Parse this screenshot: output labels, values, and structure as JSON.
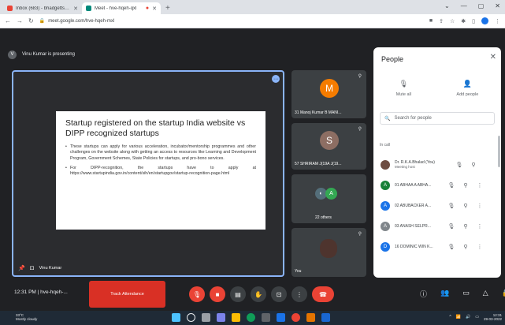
{
  "browser": {
    "tabs": [
      {
        "label": "Inbox (683) - bhadgetts@iatrc.co",
        "active": false,
        "favicon_color": "#ea4335"
      },
      {
        "label": "Meet - hve-hqeh-qxl",
        "active": true,
        "favicon_color": "#00897b"
      }
    ],
    "new_tab": "+",
    "url": "meet.google.com/hve-hqeh-mxl"
  },
  "meet": {
    "presenting_banner": "Vinu Kumar is presenting",
    "slide": {
      "title": "Startup registered on the startup India website vs DIPP recognized startups",
      "bullets": [
        "These startups can apply for various acceleration, incubator/mentorship programmes and other challenges on the website along with getting an access to resources like Learning and Development Program, Government Schemes, State Policies for startups, and pro-bono services.",
        "For DIPP-recognition, the startups have to apply at https://www.startupindia.gov.in/content/sih/en/startupgov/startup-recognition-page.html"
      ]
    },
    "main_tile_name": "Vinu Kumar",
    "side_tiles": [
      {
        "name": "31 Manoj Kumar B MANI...",
        "initial": "M",
        "color": "#f57c00"
      },
      {
        "name": "57 SHRIRAM J(19A J(19...",
        "initial": "S",
        "color": "#8d6e63"
      },
      {
        "name": "22 others",
        "initial": "A",
        "color": "#34a853"
      },
      {
        "name": "You",
        "initial": "",
        "color": "#4e342e"
      }
    ],
    "people_panel": {
      "title": "People",
      "mute_all": "Mute all",
      "add_people": "Add people",
      "search_placeholder": "Search for people",
      "section": "In call",
      "participants": [
        {
          "name": "Dr. R.K.A.Bhalad (You)",
          "sub": "Meeting host",
          "initial": "",
          "color": "#6d4c41"
        },
        {
          "name": "01 ABHAA A ABHA...",
          "sub": "",
          "initial": "A",
          "color": "#188038"
        },
        {
          "name": "02 ABUBACKER A...",
          "sub": "",
          "initial": "A",
          "color": "#1a73e8"
        },
        {
          "name": "03 ANASH SELPR...",
          "sub": "",
          "initial": "A",
          "color": "#80868b"
        },
        {
          "name": "16 DOMINIC WIN K...",
          "sub": "",
          "initial": "D",
          "color": "#1a73e8"
        }
      ]
    },
    "bottom": {
      "time_and_code": "12:31 PM  |  hve-hqeh-...",
      "track_button": "Track Attendance"
    }
  },
  "taskbar": {
    "weather": "33°C",
    "weather_sub": "Mostly cloudy",
    "time": "12:31",
    "date": "29-03-2022"
  }
}
